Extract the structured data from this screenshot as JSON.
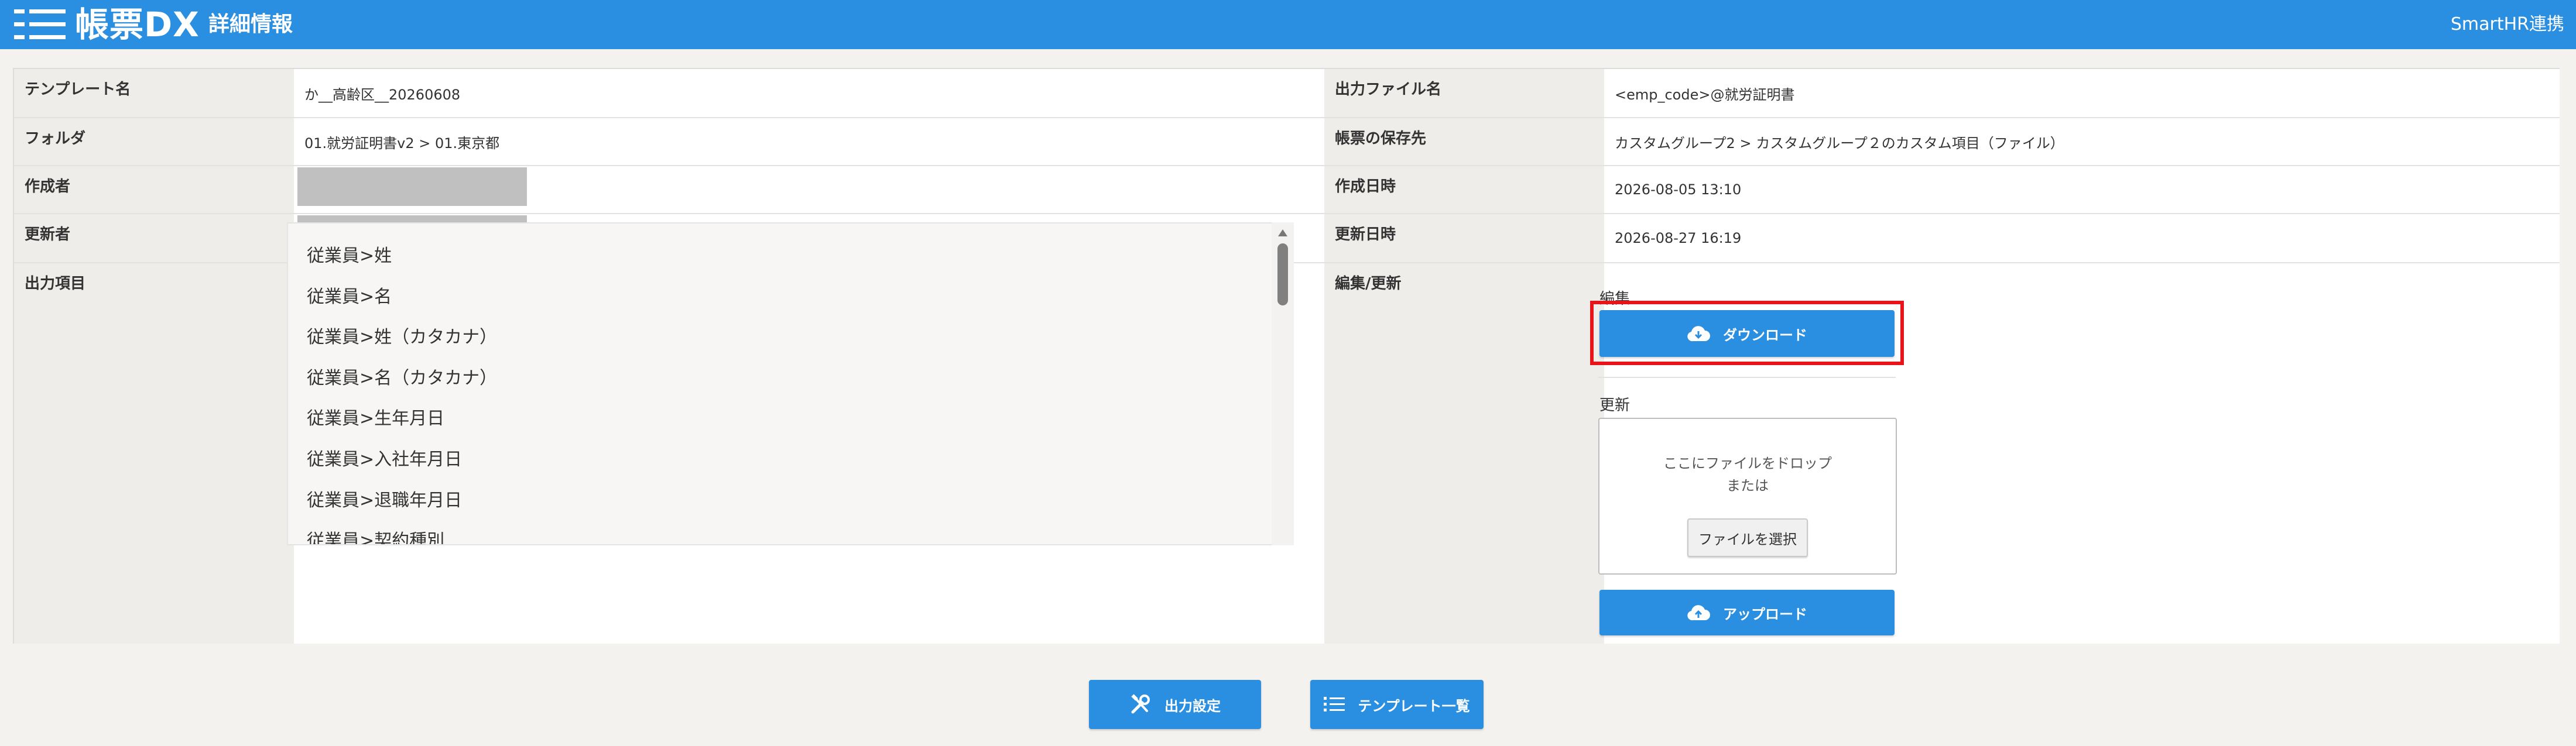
{
  "header": {
    "logo": "帳票DX",
    "title": "詳細情報",
    "link": "SmartHR連携"
  },
  "detail": {
    "rows_left": [
      {
        "label": "テンプレート名",
        "value": "か__高齢区__20260608"
      },
      {
        "label": "フォルダ",
        "value": "01.就労証明書v2 > 01.東京都"
      },
      {
        "label": "作成者",
        "value": ""
      },
      {
        "label": "更新者",
        "value": ""
      },
      {
        "label": "出力項目",
        "value": ""
      }
    ],
    "rows_right": [
      {
        "label": "出力ファイル名",
        "value": "<emp_code>@就労証明書"
      },
      {
        "label": "帳票の保存先",
        "value": "カスタムグループ2 > カスタムグループ２のカスタム項目（ファイル）"
      },
      {
        "label": "作成日時",
        "value": "2026-08-05 13:10"
      },
      {
        "label": "更新日時",
        "value": "2026-08-27 16:19"
      },
      {
        "label": "編集/更新",
        "value": ""
      }
    ]
  },
  "output_items": [
    "従業員>姓",
    "従業員>名",
    "従業員>姓（カタカナ）",
    "従業員>名（カタカナ）",
    "従業員>生年月日",
    "従業員>入社年月日",
    "従業員>退職年月日",
    "従業員>契約種別"
  ],
  "edit": {
    "edit_label": "編集",
    "download_label": "ダウンロード",
    "update_label": "更新",
    "drop_text": "ここにファイルをドロップ",
    "or_text": "または",
    "select_file_label": "ファイルを選択",
    "upload_label": "アップロード"
  },
  "footer": {
    "output_settings_label": "出力設定",
    "template_list_label": "テンプレート一覧"
  },
  "colors": {
    "header_bg": "#2a8fe0",
    "button_bg": "#2a8fe0",
    "highlight": "#e8141a"
  },
  "icons": {
    "download": "cloud-download-icon",
    "upload": "cloud-upload-icon",
    "output_settings": "tools-icon",
    "template_list": "list-icon",
    "menu": "hamburger-menu-icon"
  }
}
